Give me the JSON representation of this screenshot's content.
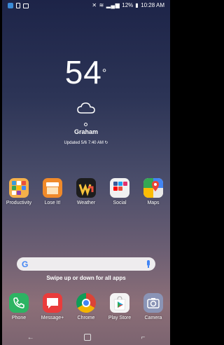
{
  "status_bar": {
    "battery_percent": "12%",
    "time": "10:28 AM",
    "icons_left": [
      "facebook-icon",
      "clipboard-icon",
      "message-icon"
    ],
    "icons_right": [
      "mute-icon",
      "wifi-icon",
      "signal-icon",
      "battery-icon"
    ]
  },
  "weather": {
    "temperature": "54",
    "degree_symbol": "°",
    "condition_icon": "cloud-icon",
    "location": "Graham",
    "updated": "Updated 5/6 7:40 AM"
  },
  "home_apps": [
    {
      "label": "Productivity",
      "icon": "folder-icon"
    },
    {
      "label": "Lose It!",
      "icon": "lose-it-icon"
    },
    {
      "label": "Weather",
      "icon": "weather-underground-icon"
    },
    {
      "label": "Social",
      "icon": "folder-icon"
    },
    {
      "label": "Maps",
      "icon": "maps-icon"
    }
  ],
  "search": {
    "logo": "G",
    "voice_icon": "mic-icon"
  },
  "swipe_hint": "Swipe up or down for all apps",
  "dock": [
    {
      "label": "Phone",
      "icon": "phone-icon"
    },
    {
      "label": "Message+",
      "icon": "message-icon"
    },
    {
      "label": "Chrome",
      "icon": "chrome-icon"
    },
    {
      "label": "Play Store",
      "icon": "play-store-icon"
    },
    {
      "label": "Camera",
      "icon": "camera-icon"
    }
  ],
  "nav_bar": {
    "back_glyph": "←",
    "recents_glyph": "⌐"
  },
  "colors": {
    "wallpaper_top": "#1d2448",
    "wallpaper_bottom": "#8c6f78",
    "search_accent": "#4285f4"
  }
}
